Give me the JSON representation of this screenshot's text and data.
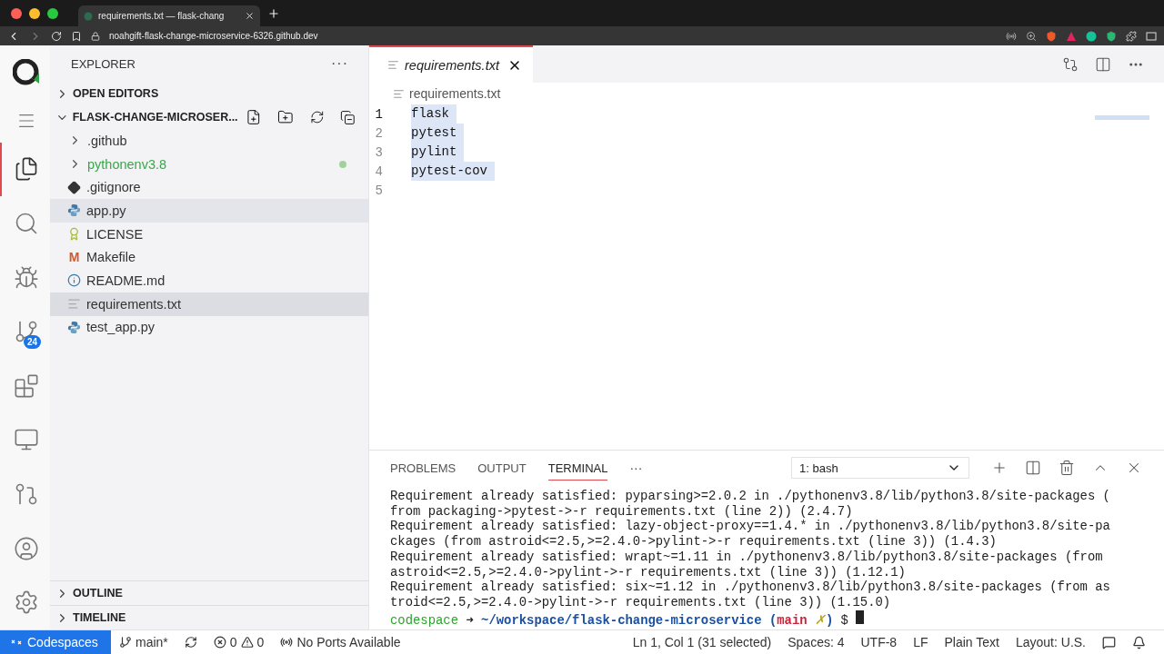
{
  "browser": {
    "tab_title": "requirements.txt — flask-chang",
    "url": "noahgift-flask-change-microservice-6326.github.dev"
  },
  "activity_bar": {
    "top": [
      {
        "kind": "explorer",
        "selected": true
      },
      {
        "kind": "search",
        "selected": false
      },
      {
        "kind": "debug",
        "selected": false
      },
      {
        "kind": "source_control",
        "selected": false,
        "badge": "24"
      },
      {
        "kind": "extensions",
        "selected": false
      },
      {
        "kind": "remote",
        "selected": false
      },
      {
        "kind": "pull_requests",
        "selected": false
      }
    ],
    "bottom": [
      {
        "kind": "accounts",
        "selected": false
      },
      {
        "kind": "settings",
        "selected": false
      }
    ]
  },
  "sidebar": {
    "title": "EXPLORER",
    "more": "···",
    "open_editors": {
      "label": "OPEN EDITORS",
      "expanded": false
    },
    "folder": {
      "label": "FLASK-CHANGE-MICROSER...",
      "expanded": true,
      "items": [
        {
          "name": ".github",
          "kind": "folder",
          "selected": false,
          "untracked": false
        },
        {
          "name": "pythonenv3.8",
          "kind": "folder",
          "selected": false,
          "untracked": true
        },
        {
          "name": ".gitignore",
          "kind": "git",
          "selected": false,
          "untracked": false
        },
        {
          "name": "app.py",
          "kind": "python",
          "selected": false,
          "hovered": true,
          "untracked": false
        },
        {
          "name": "LICENSE",
          "kind": "license",
          "selected": false,
          "untracked": false
        },
        {
          "name": "Makefile",
          "kind": "makefile",
          "icon_text": "M",
          "selected": false,
          "untracked": false
        },
        {
          "name": "README.md",
          "kind": "readme",
          "selected": false,
          "untracked": false
        },
        {
          "name": "requirements.txt",
          "kind": "text",
          "selected": true,
          "untracked": false
        },
        {
          "name": "test_app.py",
          "kind": "python",
          "selected": false,
          "untracked": false
        }
      ]
    },
    "bottom_sections": [
      {
        "label": "OUTLINE",
        "expanded": false
      },
      {
        "label": "TIMELINE",
        "expanded": false
      }
    ]
  },
  "editor": {
    "tab": {
      "title": "requirements.txt",
      "selected": true
    },
    "breadcrumb": "requirements.txt",
    "lines": [
      {
        "number": "1",
        "text": "flask",
        "current": true,
        "selected": true
      },
      {
        "number": "2",
        "text": "pytest",
        "current": false,
        "selected": true
      },
      {
        "number": "3",
        "text": "pylint",
        "current": false,
        "selected": true
      },
      {
        "number": "4",
        "text": "pytest-cov",
        "current": false,
        "selected": true
      },
      {
        "number": "5",
        "current": false
      }
    ]
  },
  "panel": {
    "tabs": [
      {
        "label": "PROBLEMS",
        "selected": false
      },
      {
        "label": "OUTPUT",
        "selected": false
      },
      {
        "label": "TERMINAL",
        "selected": true
      }
    ],
    "more": "···",
    "terminal_select": "1: bash",
    "terminal_lines": [
      "Requirement already satisfied: pyparsing>=2.0.2 in ./pythonenv3.8/lib/python3.8/site-packages (",
      "from packaging->pytest->-r requirements.txt (line 2)) (2.4.7)",
      "Requirement already satisfied: lazy-object-proxy==1.4.* in ./pythonenv3.8/lib/python3.8/site-pa",
      "ckages (from astroid<=2.5,>=2.4.0->pylint->-r requirements.txt (line 3)) (1.4.3)",
      "Requirement already satisfied: wrapt~=1.11 in ./pythonenv3.8/lib/python3.8/site-packages (from",
      "astroid<=2.5,>=2.4.0->pylint->-r requirements.txt (line 3)) (1.12.1)",
      "Requirement already satisfied: six~=1.12 in ./pythonenv3.8/lib/python3.8/site-packages (from as",
      "troid<=2.5,>=2.4.0->pylint->-r requirements.txt (line 3)) (1.15.0)"
    ],
    "prompt": [
      {
        "kind": "host",
        "text": "codespace"
      },
      {
        "kind": "arrow",
        "text": "➜"
      },
      {
        "kind": "path",
        "text": "~/workspace/flask-change-microservice"
      },
      {
        "kind": "paren",
        "text": "("
      },
      {
        "kind": "branch",
        "text": "main"
      },
      {
        "kind": "dirty",
        "text": "✗"
      },
      {
        "kind": "paren",
        "text": ")"
      },
      {
        "kind": "symbol",
        "text": "$"
      }
    ]
  },
  "status_bar": {
    "remote": "Codespaces",
    "branch": "main*",
    "errors": "0",
    "warnings": "0",
    "ports": "No Ports Available",
    "right": [
      "Ln 1, Col 1 (31 selected)",
      "Spaces: 4",
      "UTF-8",
      "LF",
      "Plain Text",
      "Layout: U.S."
    ]
  }
}
